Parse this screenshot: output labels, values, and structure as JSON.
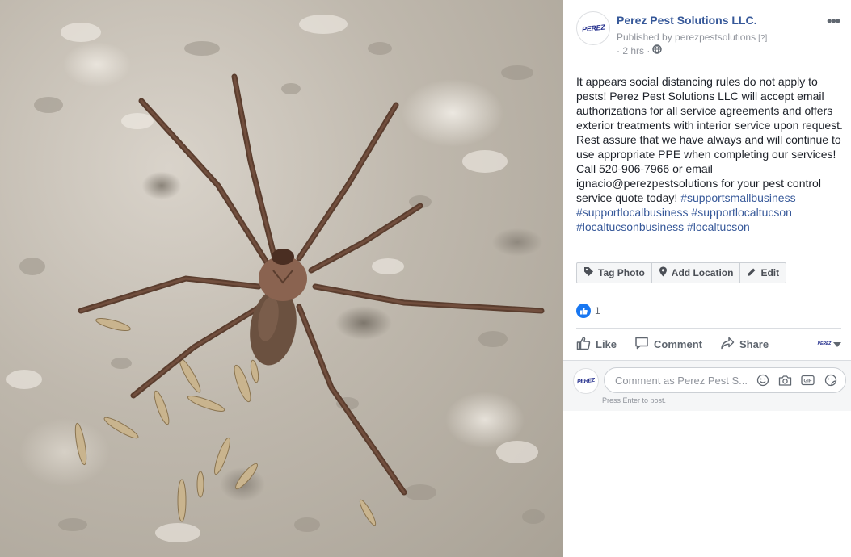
{
  "page": {
    "name": "Perez Pest Solutions LLC.",
    "avatar_text": "PEREZ",
    "published_by": "Published by perezpestsolutions",
    "help_marker": "[?]",
    "time": "· 2 hrs ·"
  },
  "post": {
    "body": "It appears social distancing rules do not apply to pests! Perez Pest Solutions LLC will accept email authorizations for all service agreements and offers exterior treatments with interior service upon request. Rest assure that we have always and will continue to use appropriate PPE when completing our services! Call 520-906-7966 or email ignacio@perezpestsolutions for your pest control service quote today!",
    "hashtags": [
      "#supportsmallbusiness",
      "#supportlocalbusiness",
      "#supportlocaltucson",
      "#localtucsonbusiness",
      "#localtucson"
    ]
  },
  "photo_actions": [
    {
      "label": "Tag Photo",
      "icon": "tag-icon"
    },
    {
      "label": "Add Location",
      "icon": "location-pin-icon"
    },
    {
      "label": "Edit",
      "icon": "pencil-icon"
    }
  ],
  "reactions": {
    "count": "1",
    "icon": "like-reaction-icon"
  },
  "actions": {
    "like": "Like",
    "comment": "Comment",
    "share": "Share"
  },
  "comment": {
    "placeholder": "Comment as Perez Pest S...",
    "hint": "Press Enter to post.",
    "gif_label": "GIF"
  },
  "colors": {
    "link": "#365899",
    "meta": "#90949c",
    "like_blue": "#1877f2"
  }
}
